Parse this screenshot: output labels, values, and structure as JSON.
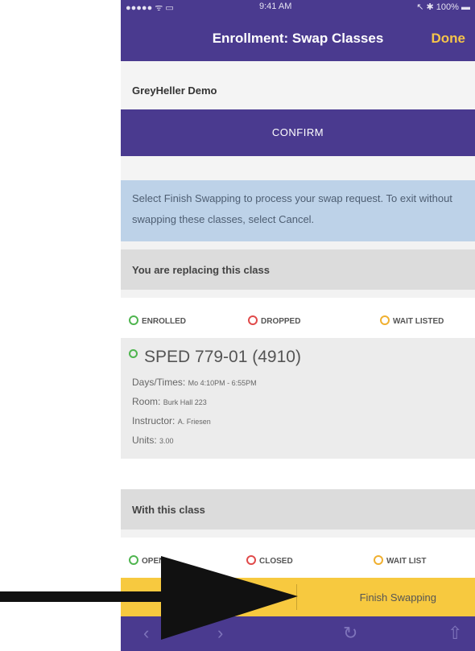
{
  "statusbar": {
    "carrier": "●●●●● ᯤ ▭",
    "time": "9:41 AM",
    "right": "↖ ✱ 100% ▬"
  },
  "header": {
    "title": "Enrollment: Swap Classes",
    "done_label": "Done"
  },
  "institution": "GreyHeller Demo",
  "confirm_label": "CONFIRM",
  "info_text": "Select Finish Swapping to process your swap request. To exit without swapping these classes, select Cancel.",
  "replacing": {
    "heading": "You are replacing this class",
    "legend": {
      "enrolled": "ENROLLED",
      "dropped": "DROPPED",
      "waitlisted": "WAIT LISTED"
    },
    "class": {
      "title": "SPED 779-01 (4910)",
      "days_label": "Days/Times:",
      "days_value": "Mo 4:10PM - 6:55PM",
      "room_label": "Room:",
      "room_value": "Burk Hall 223",
      "instructor_label": "Instructor:",
      "instructor_value": "A. Friesen",
      "units_label": "Units:",
      "units_value": "3.00"
    }
  },
  "with_class": {
    "heading": "With this class",
    "legend": {
      "open": "OPEN",
      "closed": "CLOSED",
      "waitlist": "WAIT LIST"
    }
  },
  "finish_label": "Finish Swapping",
  "toolbar": {
    "back": "‹",
    "forward": "›",
    "reload": "↻",
    "share": "⇧"
  },
  "colors": {
    "brand": "#4a3a8f",
    "accent": "#f7c93f",
    "info": "#bdd2e8"
  }
}
